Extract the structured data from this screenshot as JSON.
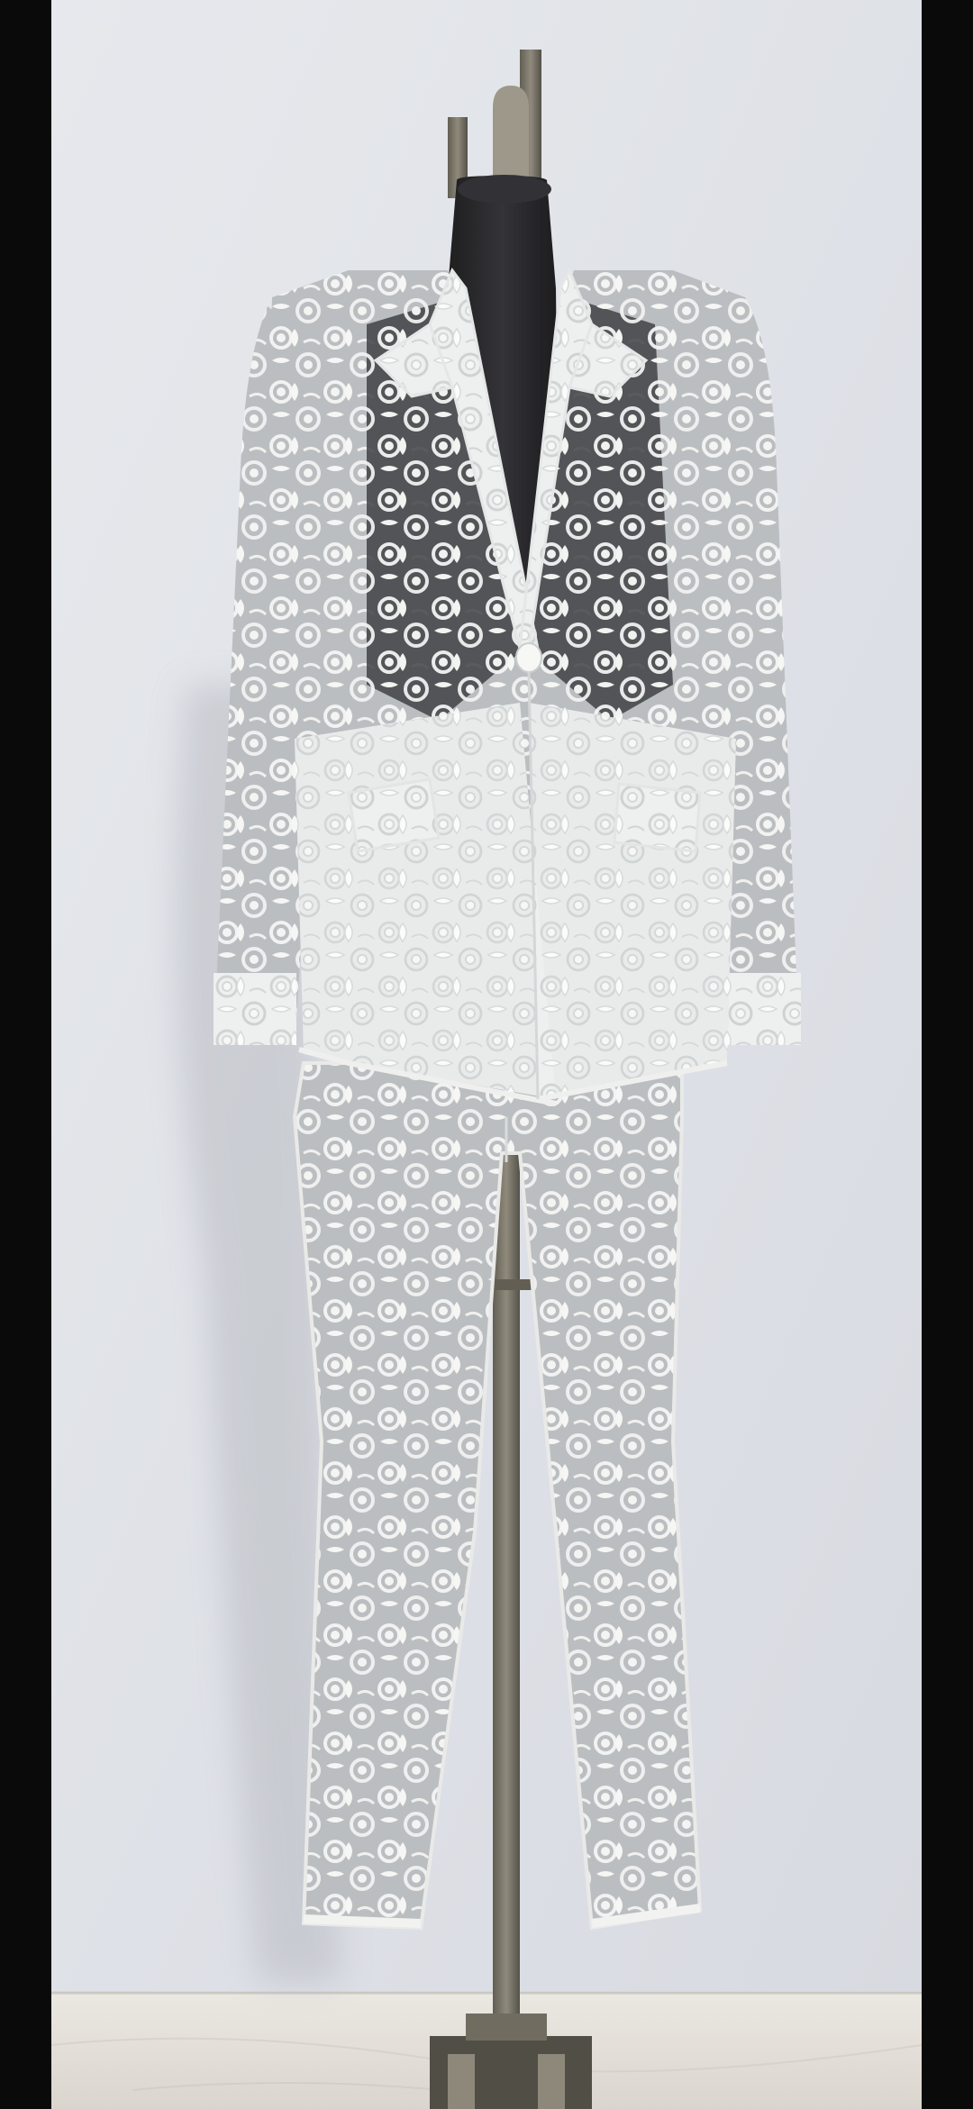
{
  "photo": {
    "subject": "lace-suit-on-mannequin",
    "colors": {
      "background_wall": "#dfe2e8",
      "floor": "#e6e2dc",
      "lace_white": "#f4f4f2",
      "lace_shadow": "#c9cccf",
      "mannequin_black": "#1e1e20",
      "stand_metal": "#6e6a5e",
      "letterbox": "#0a0a0a"
    }
  }
}
